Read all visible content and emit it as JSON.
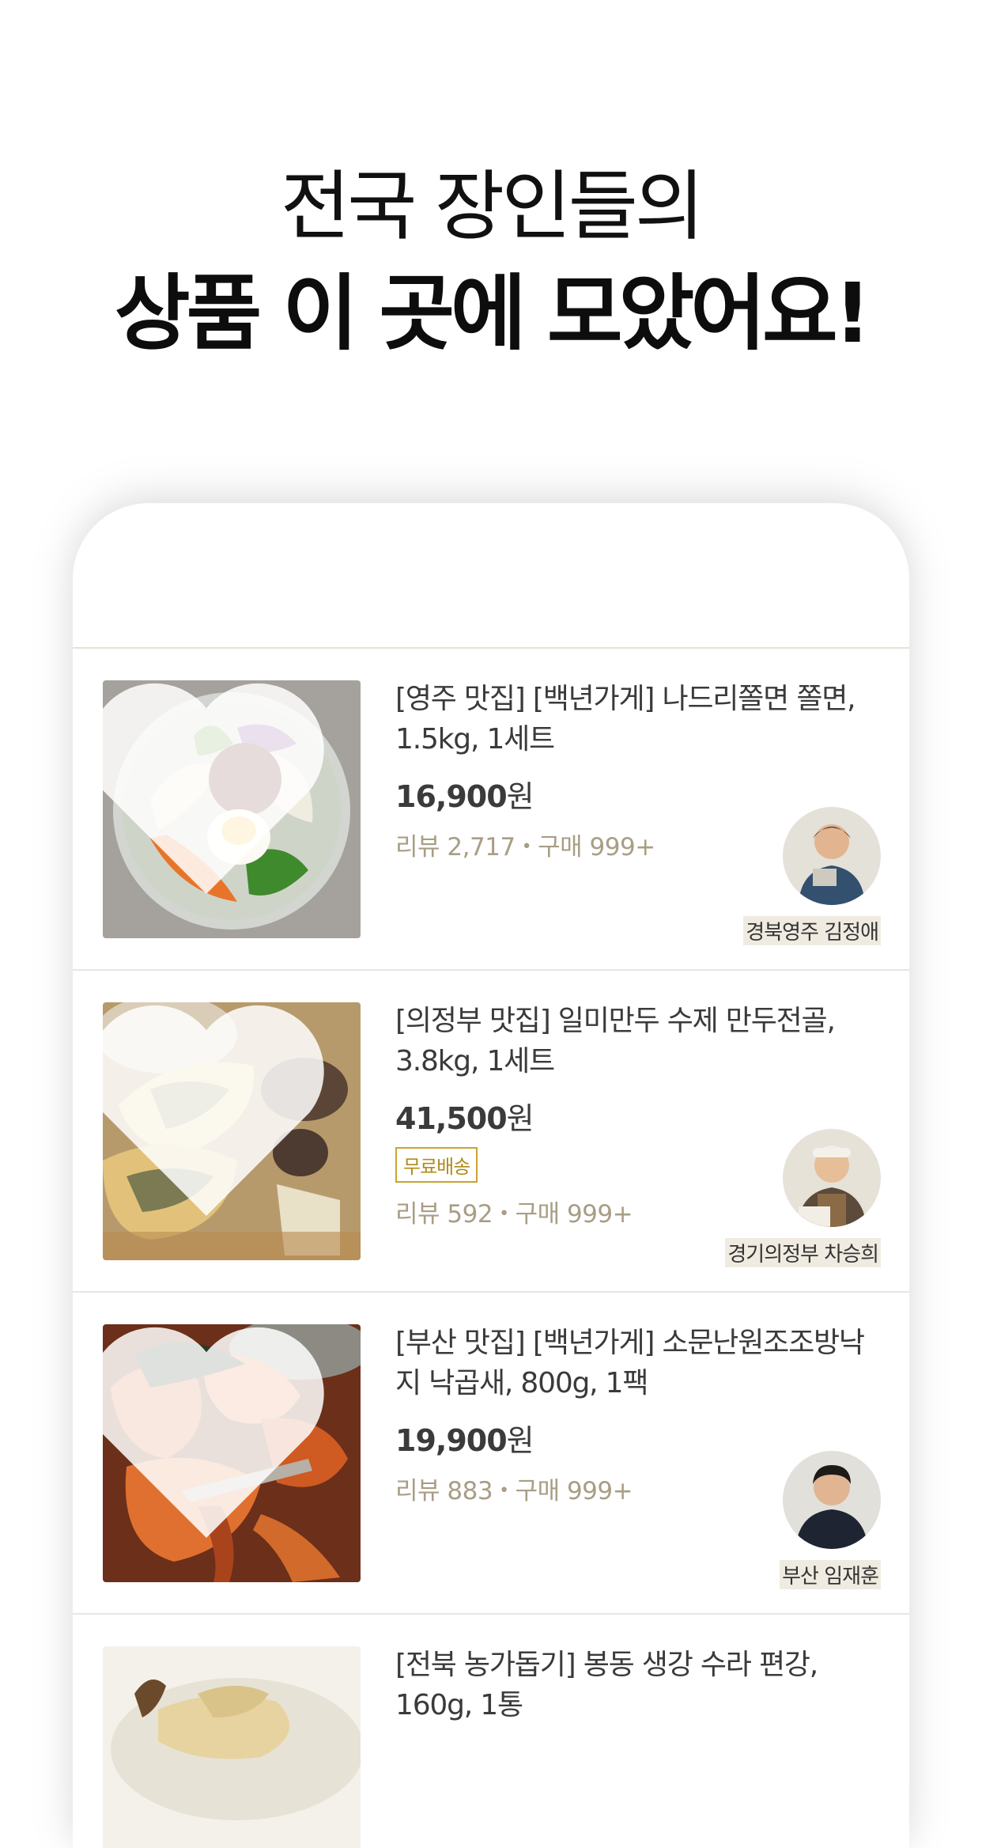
{
  "headline": {
    "line1": "전국 장인들의",
    "line2": "상품 이 곳에 모았어요!"
  },
  "products": [
    {
      "title": "[영주 맛집] [백년가게] 나드리쫄면 쫄면, 1.5kg, 1세트",
      "price": "16,900",
      "currency": "원",
      "reviews": "리뷰 2,717",
      "purchases": "구매 999+",
      "seller": "경북영주 김정애",
      "image": "bibim-noodle-bowl"
    },
    {
      "title": "[의정부 맛집] 일미만두 수제 만두전골, 3.8kg, 1세트",
      "price": "41,500",
      "currency": "원",
      "badge": "무료배송",
      "reviews": "리뷰 592",
      "purchases": "구매 999+",
      "seller": "경기의정부 차승희",
      "image": "dumpling-hotpot"
    },
    {
      "title": "[부산 맛집] [백년가게] 소문난원조조방낙지 낙곱새, 800g, 1팩",
      "price": "19,900",
      "currency": "원",
      "reviews": "리뷰 883",
      "purchases": "구매 999+",
      "seller": "부산 임재훈",
      "image": "octopus-shrimp-stew"
    },
    {
      "title": "[전북 농가돕기] 봉동 생강 수라 편강, 160g, 1통",
      "image": "ginger-candy"
    }
  ],
  "dot": "•",
  "colors": {
    "badge": "#c9a331",
    "meta": "#a89e85",
    "divider": "#e9e6df"
  }
}
